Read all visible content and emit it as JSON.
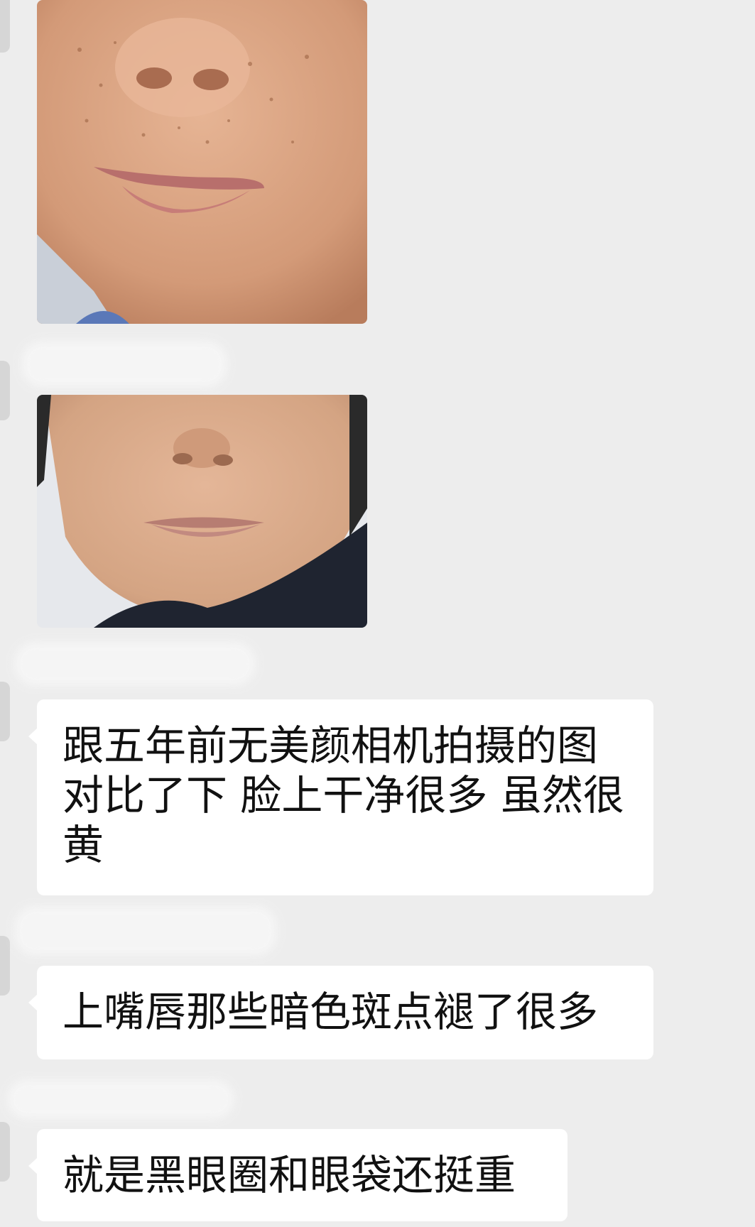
{
  "messages": [
    {
      "type": "image",
      "subject": "face-closeup-before"
    },
    {
      "type": "image",
      "subject": "face-closeup-after"
    },
    {
      "type": "text",
      "text": "跟五年前无美颜相机拍摄的图对比了下 脸上干净很多 虽然很黄"
    },
    {
      "type": "text",
      "text": "上嘴唇那些暗色斑点褪了很多"
    },
    {
      "type": "text",
      "text": "就是黑眼圈和眼袋还挺重"
    }
  ],
  "colors": {
    "chat_background": "#ededed",
    "bubble_background": "#ffffff",
    "text": "#111111"
  }
}
